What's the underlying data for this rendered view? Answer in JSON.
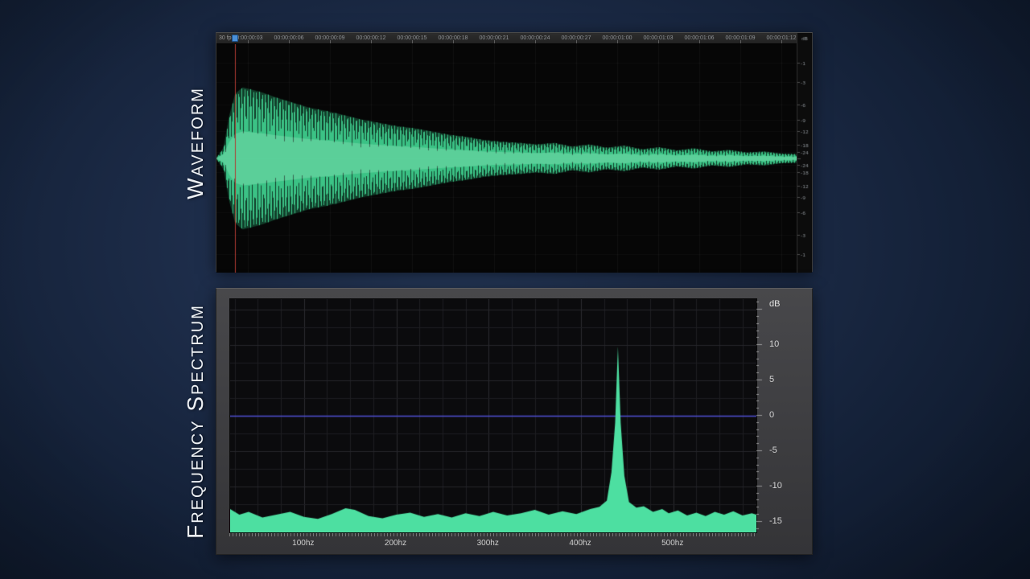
{
  "colors": {
    "wave_green": "#40d08f",
    "wave_body_green": "rgba(38,150,100,0.38)",
    "wave_core": "rgba(205,255,228,0.22)",
    "spectrum_green": "#4ddfa1",
    "zero_line_blue": "#4b4bc8",
    "playhead_red": "#b03b32",
    "playhead_handle_blue": "#4a90d9"
  },
  "panels": {
    "waveform": {
      "label": "Waveform",
      "fps": "30 fps",
      "db_unit": "dB",
      "ruler_timestamps": [
        "00:00:00:03",
        "00:00:00:06",
        "00:00:00:09",
        "00:00:00:12",
        "00:00:00:15",
        "00:00:00:18",
        "00:00:00:21",
        "00:00:00:24",
        "00:00:00:27",
        "00:00:01:00",
        "00:00:01:03",
        "00:00:01:06",
        "00:00:01:09",
        "00:00:01:12"
      ],
      "db_scale": [
        -1,
        -3,
        -6,
        -9,
        -12,
        -18,
        -24
      ]
    },
    "spectrum": {
      "label": "Frequency Spectrum",
      "db_unit": "dB",
      "y_tick_labels": [
        "10",
        "5",
        "0",
        "-5",
        "-10",
        "-15"
      ],
      "y_tick_values": [
        10,
        5,
        0,
        -5,
        -10,
        -15
      ],
      "x_tick_labels": [
        "100hz",
        "200hz",
        "300hz",
        "400hz",
        "500hz"
      ],
      "x_tick_values": [
        100,
        200,
        300,
        400,
        500
      ]
    }
  },
  "chart_data": [
    {
      "type": "area",
      "name": "waveform",
      "title": "Waveform",
      "x_axis": "time, timecode at 30 fps",
      "x_ticks": [
        "00:00:00:03",
        "00:00:00:06",
        "00:00:00:09",
        "00:00:00:12",
        "00:00:00:15",
        "00:00:00:18",
        "00:00:00:21",
        "00:00:00:24",
        "00:00:00:27",
        "00:00:01:00",
        "00:00:01:03",
        "00:00:01:06",
        "00:00:01:09",
        "00:00:01:12"
      ],
      "y_axis": "amplitude (dB, symmetric)",
      "y_db_ticks": [
        -1,
        -3,
        -6,
        -9,
        -12,
        -18,
        -24
      ],
      "description": "Decaying tone: sharp attack then exponential decay with beating bumps in the tail",
      "envelope": {
        "t": [
          0,
          0.012,
          0.022,
          0.032,
          0.045,
          0.06,
          0.08,
          0.1,
          0.13,
          0.16,
          0.19,
          0.22,
          0.25,
          0.28,
          0.31,
          0.34,
          0.37,
          0.4,
          0.43,
          0.46,
          0.49,
          0.52,
          0.55,
          0.58,
          0.61,
          0.64,
          0.67,
          0.7,
          0.73,
          0.76,
          0.79,
          0.82,
          0.85,
          0.88,
          0.91,
          0.94,
          0.97,
          1
        ],
        "amp": [
          0.01,
          0.1,
          0.4,
          0.6,
          0.66,
          0.64,
          0.61,
          0.57,
          0.52,
          0.47,
          0.44,
          0.4,
          0.36,
          0.33,
          0.3,
          0.28,
          0.25,
          0.22,
          0.2,
          0.17,
          0.155,
          0.145,
          0.13,
          0.145,
          0.11,
          0.13,
          0.1,
          0.12,
          0.085,
          0.105,
          0.075,
          0.095,
          0.065,
          0.08,
          0.055,
          0.065,
          0.045,
          0.04
        ]
      },
      "playhead_timecode_x": 0.032
    },
    {
      "type": "area",
      "name": "frequency-spectrum",
      "title": "Frequency Spectrum",
      "xlabel": "frequency (hz)",
      "ylabel": "dB",
      "x_ticks": [
        "100hz",
        "200hz",
        "300hz",
        "400hz",
        "500hz"
      ],
      "y_ticks": [
        10,
        5,
        0,
        -5,
        -10,
        -15
      ],
      "x_range_hz": [
        20,
        590
      ],
      "y_range_db": [
        -16.5,
        16.5
      ],
      "zero_line_db": 0,
      "peak": {
        "hz": 440,
        "db": 9.8
      },
      "noise_floor_db": -14,
      "points": {
        "hz": [
          20,
          30,
          40,
          55,
          70,
          85,
          100,
          115,
          130,
          145,
          155,
          170,
          185,
          200,
          215,
          230,
          245,
          260,
          275,
          290,
          305,
          320,
          335,
          350,
          365,
          380,
          395,
          410,
          420,
          428,
          433,
          437,
          440,
          443,
          447,
          452,
          460,
          468,
          478,
          488,
          495,
          505,
          515,
          525,
          535,
          545,
          555,
          565,
          575,
          585,
          590
        ],
        "db": [
          -13.2,
          -14,
          -13.6,
          -14.4,
          -14,
          -13.6,
          -14.3,
          -14.6,
          -13.9,
          -13.1,
          -13.3,
          -14.2,
          -14.5,
          -14,
          -13.7,
          -14.3,
          -13.9,
          -14.4,
          -13.8,
          -14.2,
          -13.6,
          -14.1,
          -13.8,
          -13.3,
          -14,
          -13.5,
          -13.9,
          -13.2,
          -12.9,
          -12,
          -8,
          -1,
          9.8,
          -1,
          -8.5,
          -12.2,
          -13,
          -12.8,
          -13.6,
          -13.2,
          -13.8,
          -13.4,
          -14.1,
          -13.7,
          -14.2,
          -13.6,
          -14,
          -13.5,
          -14.1,
          -13.8,
          -14
        ]
      }
    }
  ]
}
